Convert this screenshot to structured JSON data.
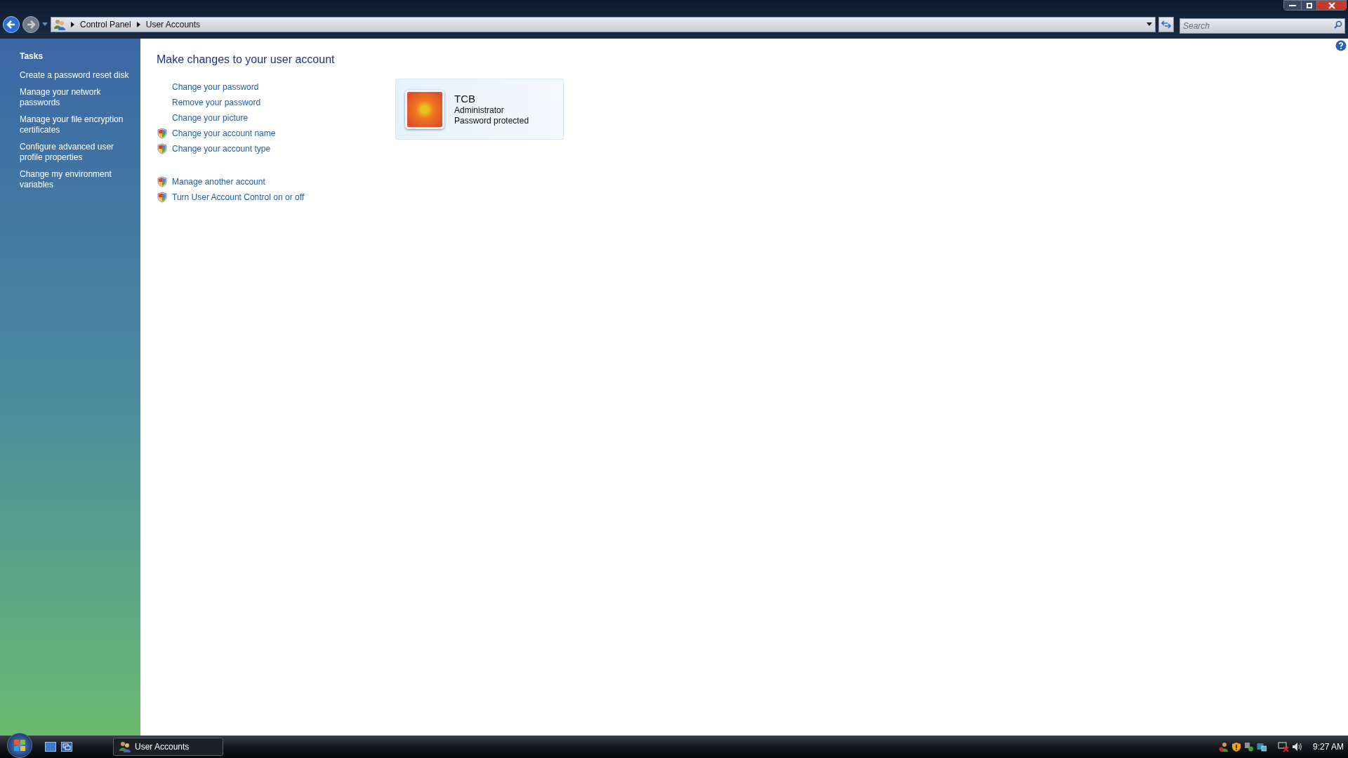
{
  "address_bar": {
    "crumbs": [
      "Control Panel",
      "User Accounts"
    ]
  },
  "search": {
    "placeholder": "Search"
  },
  "sidebar": {
    "title": "Tasks",
    "items": [
      "Create a password reset disk",
      "Manage your network passwords",
      "Manage your file encryption certificates",
      "Configure advanced user profile properties",
      "Change my environment variables"
    ]
  },
  "main": {
    "heading": "Make changes to your user account",
    "link_groups": [
      [
        {
          "label": "Change your password",
          "kind": "plain"
        },
        {
          "label": "Remove your password",
          "kind": "plain"
        },
        {
          "label": "Change your picture",
          "kind": "plain"
        },
        {
          "label": "Change your account name",
          "kind": "uac"
        },
        {
          "label": "Change your account type",
          "kind": "uac"
        }
      ],
      [
        {
          "label": "Manage another account",
          "kind": "uac"
        },
        {
          "label": "Turn User Account Control on or off",
          "kind": "uac"
        }
      ]
    ],
    "account": {
      "name": "TCB",
      "type": "Administrator",
      "status": "Password protected"
    }
  },
  "taskbar": {
    "buttons": [
      {
        "label": "User Accounts",
        "selected": true
      }
    ],
    "clock": "9:27 AM"
  }
}
